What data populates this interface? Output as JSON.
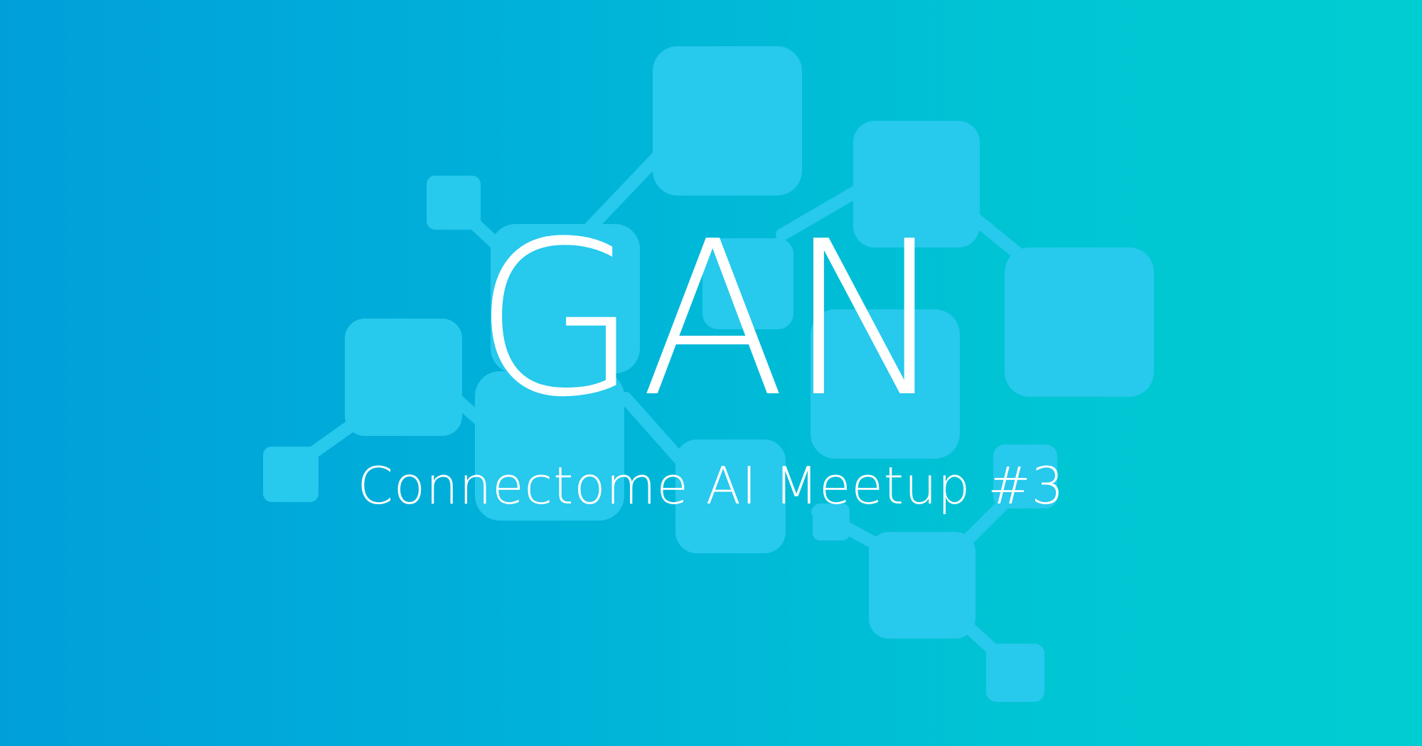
{
  "banner": {
    "title": "GAN",
    "subtitle": "Connectome AI Meetup #3",
    "background_gradient": [
      "#009fda",
      "#00cdd2"
    ],
    "graphic_color": "#27c9ec",
    "text_color": "#ffffff"
  },
  "graphic": {
    "icon": "network-graph-icon"
  }
}
